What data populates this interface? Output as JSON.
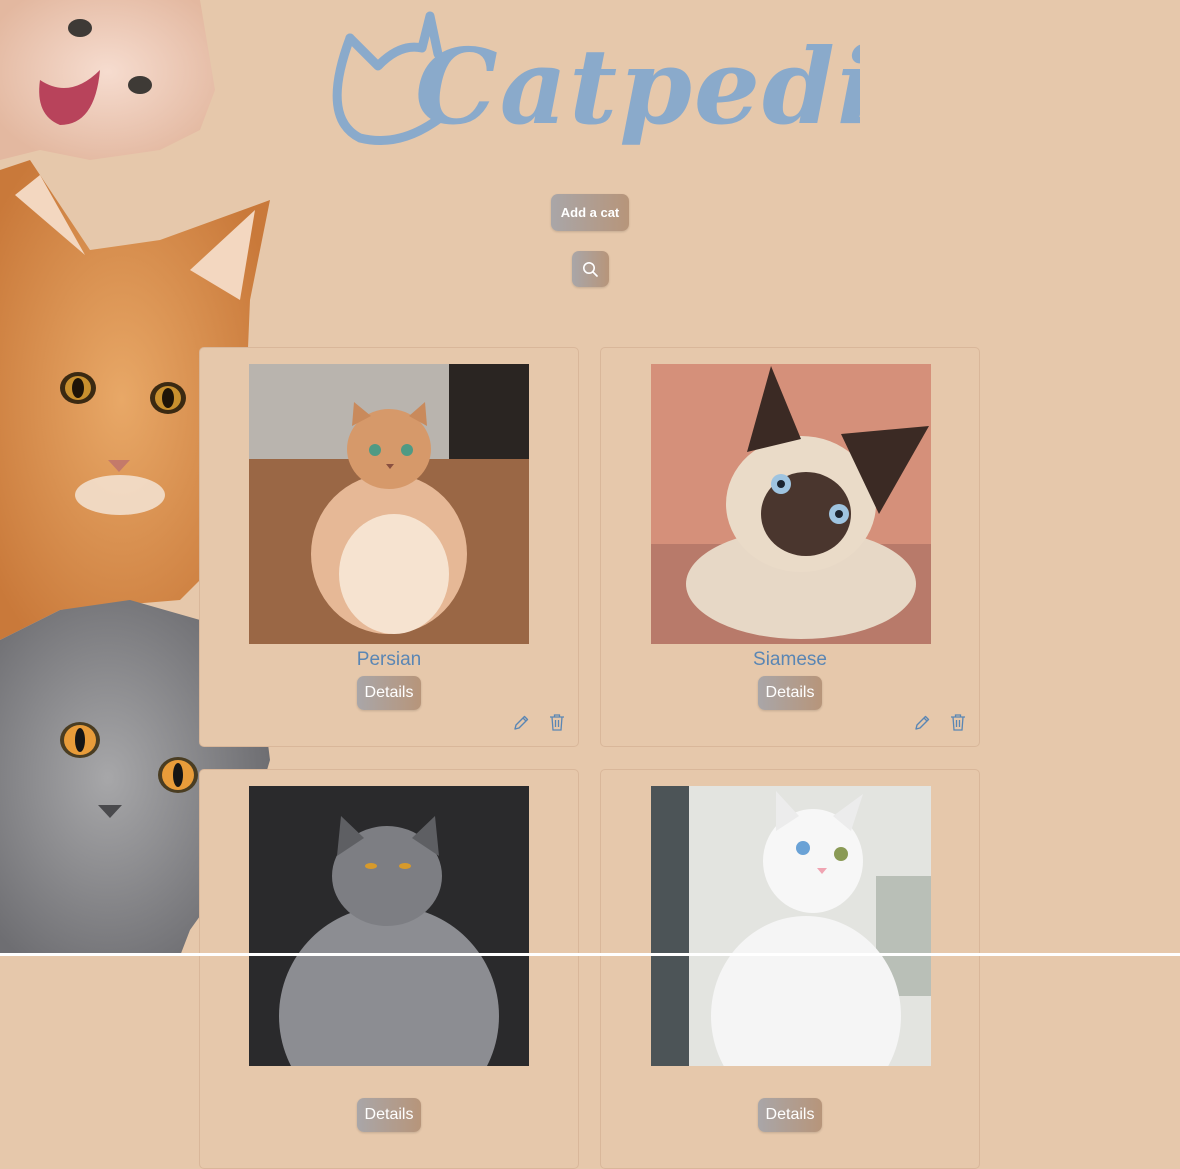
{
  "header": {
    "logo_text": "Catpedia"
  },
  "actions": {
    "add_label": "Add a cat"
  },
  "cats": [
    {
      "name": "Persian",
      "details_label": "Details"
    },
    {
      "name": "Siamese",
      "details_label": "Details"
    },
    {
      "name": "",
      "details_label": "Details"
    },
    {
      "name": "",
      "details_label": "Details"
    }
  ],
  "colors": {
    "background": "#e6c8ab",
    "logo": "#8aaacb",
    "name": "#5a86b4",
    "button_start": "#a9a6a8",
    "button_end": "#b7957a"
  },
  "icons": [
    "cat-ear-logo-icon",
    "search-icon",
    "pencil-icon",
    "trash-icon"
  ]
}
